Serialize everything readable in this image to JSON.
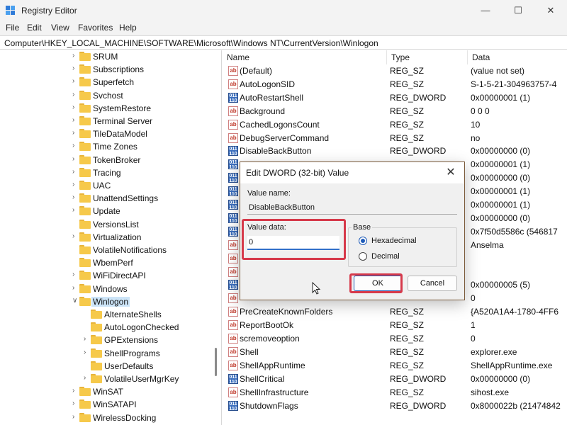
{
  "window": {
    "title": "Registry Editor",
    "minimize_glyph": "—",
    "maximize_glyph": "☐",
    "close_glyph": "✕"
  },
  "menu": [
    "File",
    "Edit",
    "View",
    "Favorites",
    "Help"
  ],
  "address": "Computer\\HKEY_LOCAL_MACHINE\\SOFTWARE\\Microsoft\\Windows NT\\CurrentVersion\\Winlogon",
  "tree": [
    {
      "label": "SRUM",
      "expandable": true,
      "level": 0
    },
    {
      "label": "Subscriptions",
      "expandable": true,
      "level": 0
    },
    {
      "label": "Superfetch",
      "expandable": true,
      "level": 0
    },
    {
      "label": "Svchost",
      "expandable": true,
      "level": 0
    },
    {
      "label": "SystemRestore",
      "expandable": true,
      "level": 0
    },
    {
      "label": "Terminal Server",
      "expandable": true,
      "level": 0
    },
    {
      "label": "TileDataModel",
      "expandable": true,
      "level": 0
    },
    {
      "label": "Time Zones",
      "expandable": true,
      "level": 0
    },
    {
      "label": "TokenBroker",
      "expandable": true,
      "level": 0
    },
    {
      "label": "Tracing",
      "expandable": true,
      "level": 0
    },
    {
      "label": "UAC",
      "expandable": true,
      "level": 0
    },
    {
      "label": "UnattendSettings",
      "expandable": true,
      "level": 0
    },
    {
      "label": "Update",
      "expandable": true,
      "level": 0
    },
    {
      "label": "VersionsList",
      "expandable": false,
      "level": 0
    },
    {
      "label": "Virtualization",
      "expandable": true,
      "level": 0
    },
    {
      "label": "VolatileNotifications",
      "expandable": false,
      "level": 0
    },
    {
      "label": "WbemPerf",
      "expandable": false,
      "level": 0
    },
    {
      "label": "WiFiDirectAPI",
      "expandable": true,
      "level": 0
    },
    {
      "label": "Windows",
      "expandable": true,
      "level": 0
    },
    {
      "label": "Winlogon",
      "expandable": true,
      "expanded": true,
      "selected": true,
      "level": 0
    },
    {
      "label": "AlternateShells",
      "expandable": false,
      "level": 1
    },
    {
      "label": "AutoLogonChecked",
      "expandable": false,
      "level": 1
    },
    {
      "label": "GPExtensions",
      "expandable": true,
      "level": 1
    },
    {
      "label": "ShellPrograms",
      "expandable": true,
      "level": 1
    },
    {
      "label": "UserDefaults",
      "expandable": false,
      "level": 1
    },
    {
      "label": "VolatileUserMgrKey",
      "expandable": true,
      "level": 1
    },
    {
      "label": "WinSAT",
      "expandable": true,
      "level": 0
    },
    {
      "label": "WinSATAPI",
      "expandable": true,
      "level": 0
    },
    {
      "label": "WirelessDocking",
      "expandable": true,
      "level": 0
    }
  ],
  "columns": {
    "name": "Name",
    "type": "Type",
    "data": "Data"
  },
  "values": [
    {
      "name": "(Default)",
      "type": "REG_SZ",
      "data": "(value not set)",
      "kind": "sz"
    },
    {
      "name": "AutoLogonSID",
      "type": "REG_SZ",
      "data": "S-1-5-21-304963757-4",
      "kind": "sz"
    },
    {
      "name": "AutoRestartShell",
      "type": "REG_DWORD",
      "data": "0x00000001 (1)",
      "kind": "dw"
    },
    {
      "name": "Background",
      "type": "REG_SZ",
      "data": "0 0 0",
      "kind": "sz"
    },
    {
      "name": "CachedLogonsCount",
      "type": "REG_SZ",
      "data": "10",
      "kind": "sz"
    },
    {
      "name": "DebugServerCommand",
      "type": "REG_SZ",
      "data": "no",
      "kind": "sz"
    },
    {
      "name": "DisableBackButton",
      "type": "REG_DWORD",
      "data": "0x00000000 (0)",
      "kind": "dw"
    },
    {
      "name": "",
      "type": "",
      "data": "0x00000001 (1)",
      "kind": "dw"
    },
    {
      "name": "",
      "type": "",
      "data": "0x00000000 (0)",
      "kind": "dw"
    },
    {
      "name": "",
      "type": "",
      "data": "0x00000001 (1)",
      "kind": "dw"
    },
    {
      "name": "",
      "type": "",
      "data": "0x00000001 (1)",
      "kind": "dw"
    },
    {
      "name": "",
      "type": "",
      "data": "0x00000000 (0)",
      "kind": "dw"
    },
    {
      "name": "",
      "type": "",
      "data": "0x7f50d5586c (546817",
      "kind": "dw"
    },
    {
      "name": "",
      "type": "",
      "data": "Anselma",
      "kind": "sz"
    },
    {
      "name": "",
      "type": "",
      "data": "",
      "kind": "sz"
    },
    {
      "name": "",
      "type": "",
      "data": "",
      "kind": "sz"
    },
    {
      "name": "",
      "type": "",
      "data": "0x00000005 (5)",
      "kind": "dw"
    },
    {
      "name": "",
      "type": "",
      "data": "0",
      "kind": "sz"
    },
    {
      "name": "PreCreateKnownFolders",
      "type": "REG_SZ",
      "data": "{A520A1A4-1780-4FF6",
      "kind": "sz"
    },
    {
      "name": "ReportBootOk",
      "type": "REG_SZ",
      "data": "1",
      "kind": "sz"
    },
    {
      "name": "scremoveoption",
      "type": "REG_SZ",
      "data": "0",
      "kind": "sz"
    },
    {
      "name": "Shell",
      "type": "REG_SZ",
      "data": "explorer.exe",
      "kind": "sz"
    },
    {
      "name": "ShellAppRuntime",
      "type": "REG_SZ",
      "data": "ShellAppRuntime.exe",
      "kind": "sz"
    },
    {
      "name": "ShellCritical",
      "type": "REG_DWORD",
      "data": "0x00000000 (0)",
      "kind": "dw"
    },
    {
      "name": "ShellInfrastructure",
      "type": "REG_SZ",
      "data": "sihost.exe",
      "kind": "sz"
    },
    {
      "name": "ShutdownFlags",
      "type": "REG_DWORD",
      "data": "0x8000022b (21474842",
      "kind": "dw"
    }
  ],
  "icons": {
    "sz": "ab",
    "dw": "011 110"
  },
  "dialog": {
    "title": "Edit DWORD (32-bit) Value",
    "close_glyph": "✕",
    "value_name_label": "Value name:",
    "value_name": "DisableBackButton",
    "value_data_label": "Value data:",
    "value_data": "0",
    "base_label": "Base",
    "hex_label": "Hexadecimal",
    "dec_label": "Decimal",
    "base_selected": "hexadecimal",
    "ok_label": "OK",
    "cancel_label": "Cancel"
  },
  "colors": {
    "highlight": "#d6394a",
    "accent": "#1e5bb8",
    "folder": "#f6c94a"
  }
}
